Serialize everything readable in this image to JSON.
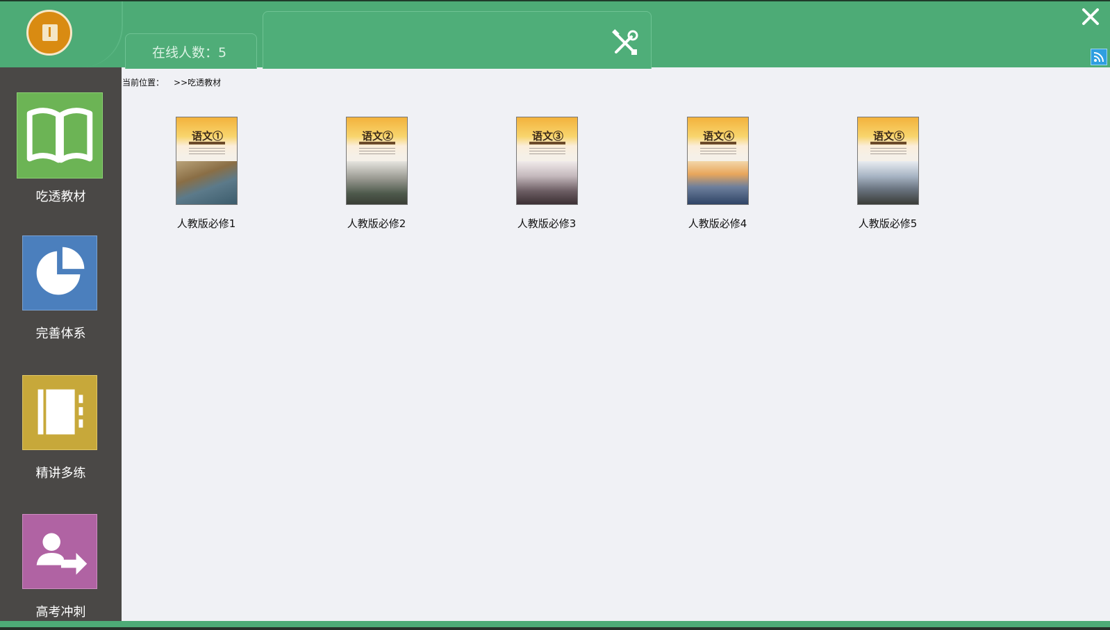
{
  "header": {
    "online_label": "在线人数：5"
  },
  "sidebar": {
    "items": [
      {
        "label": "吃透教材",
        "color": "#6cb455",
        "icon": "book-icon"
      },
      {
        "label": "完善体系",
        "color": "#4b7fbd",
        "icon": "pie-chart-icon"
      },
      {
        "label": "精讲多练",
        "color": "#c7a83a",
        "icon": "notebook-icon"
      },
      {
        "label": "高考冲刺",
        "color": "#b063a3",
        "icon": "user-arrow-icon"
      }
    ]
  },
  "breadcrumb": {
    "prefix": "当前位置：",
    "path": ">>吃透教材"
  },
  "books": [
    {
      "label": "人教版必修1",
      "cover_title": "语文①"
    },
    {
      "label": "人教版必修2",
      "cover_title": "语文②"
    },
    {
      "label": "人教版必修3",
      "cover_title": "语文③"
    },
    {
      "label": "人教版必修4",
      "cover_title": "语文④"
    },
    {
      "label": "人教版必修5",
      "cover_title": "语文⑤"
    }
  ],
  "colors": {
    "header_green": "#4dab76",
    "sidebar_dark": "#4a4846",
    "content_bg": "#f0f1f5"
  }
}
